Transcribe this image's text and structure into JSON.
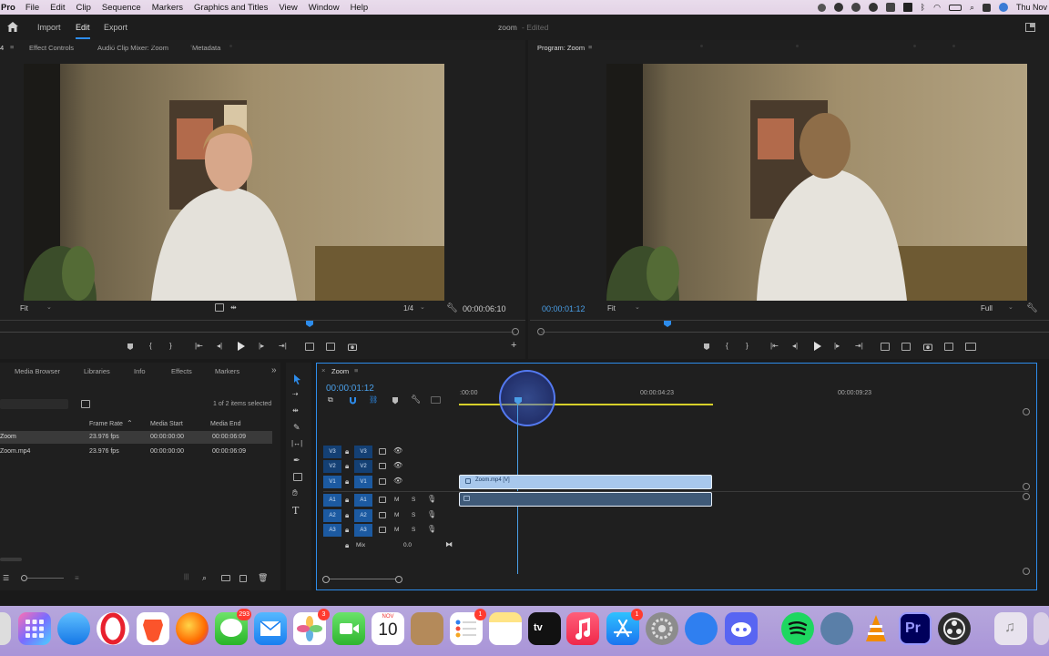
{
  "menubar": {
    "app": "Pro",
    "items": [
      "File",
      "Edit",
      "Clip",
      "Sequence",
      "Markers",
      "Graphics and Titles",
      "View",
      "Window",
      "Help"
    ],
    "clock": "Thu Nov"
  },
  "header": {
    "tabs": [
      "Import",
      "Edit",
      "Export"
    ],
    "active_tab": "Edit",
    "project_name": "zoom",
    "project_status": "- Edited"
  },
  "source_monitor": {
    "tab_prefix": "4",
    "tabs": [
      "Effect Controls",
      "Audio Clip Mixer: Zoom",
      "Metadata"
    ],
    "fit": "Fit",
    "resolution": "1/4",
    "duration": "00:00:06:10"
  },
  "program_monitor": {
    "title": "Program: Zoom",
    "timecode": "00:00:01:12",
    "fit": "Fit",
    "resolution": "Full"
  },
  "project_panel": {
    "tabs": [
      "Media Browser",
      "Libraries",
      "Info",
      "Effects",
      "Markers"
    ],
    "selection_status": "1 of 2 items selected",
    "columns": [
      "Frame Rate",
      "Media Start",
      "Media End"
    ],
    "rows": [
      {
        "name": "Zoom",
        "frame_rate": "23.976 fps",
        "media_start": "00:00:00:00",
        "media_end": "00:00:06:09",
        "selected": true
      },
      {
        "name": "Zoom.mp4",
        "frame_rate": "23.976 fps",
        "media_start": "00:00:00:00",
        "media_end": "00:00:06:09",
        "selected": false
      }
    ]
  },
  "timeline": {
    "sequence": "Zoom",
    "timecode": "00:00:01:12",
    "ruler": ":00:00",
    "ruler_mid": "00:00:04:23",
    "ruler_end": "00:00:09:23",
    "video_tracks": [
      {
        "tb": "V3",
        "id": "V3"
      },
      {
        "tb": "V2",
        "id": "V2"
      },
      {
        "tb": "V1",
        "id": "V1"
      }
    ],
    "audio_tracks": [
      {
        "tb": "A1",
        "id": "A1"
      },
      {
        "tb": "A2",
        "id": "A2"
      },
      {
        "tb": "A3",
        "id": "A3"
      }
    ],
    "mix_label": "Mix",
    "mix_value": "0.0",
    "video_clip_label": "Zoom.mp4 [V]",
    "mute_label": "M",
    "solo_label": "S"
  },
  "dock": {
    "badges": {
      "messages": "293",
      "photos": "3",
      "reminders": "1",
      "appstore": "1"
    },
    "calendar_month": "NOV",
    "calendar_day": "10"
  },
  "colors": {
    "accent": "#2d8ceb",
    "timecode": "#4a9fe8",
    "video_clip": "#a8c8ec",
    "playhead": "#4a9fe8"
  }
}
